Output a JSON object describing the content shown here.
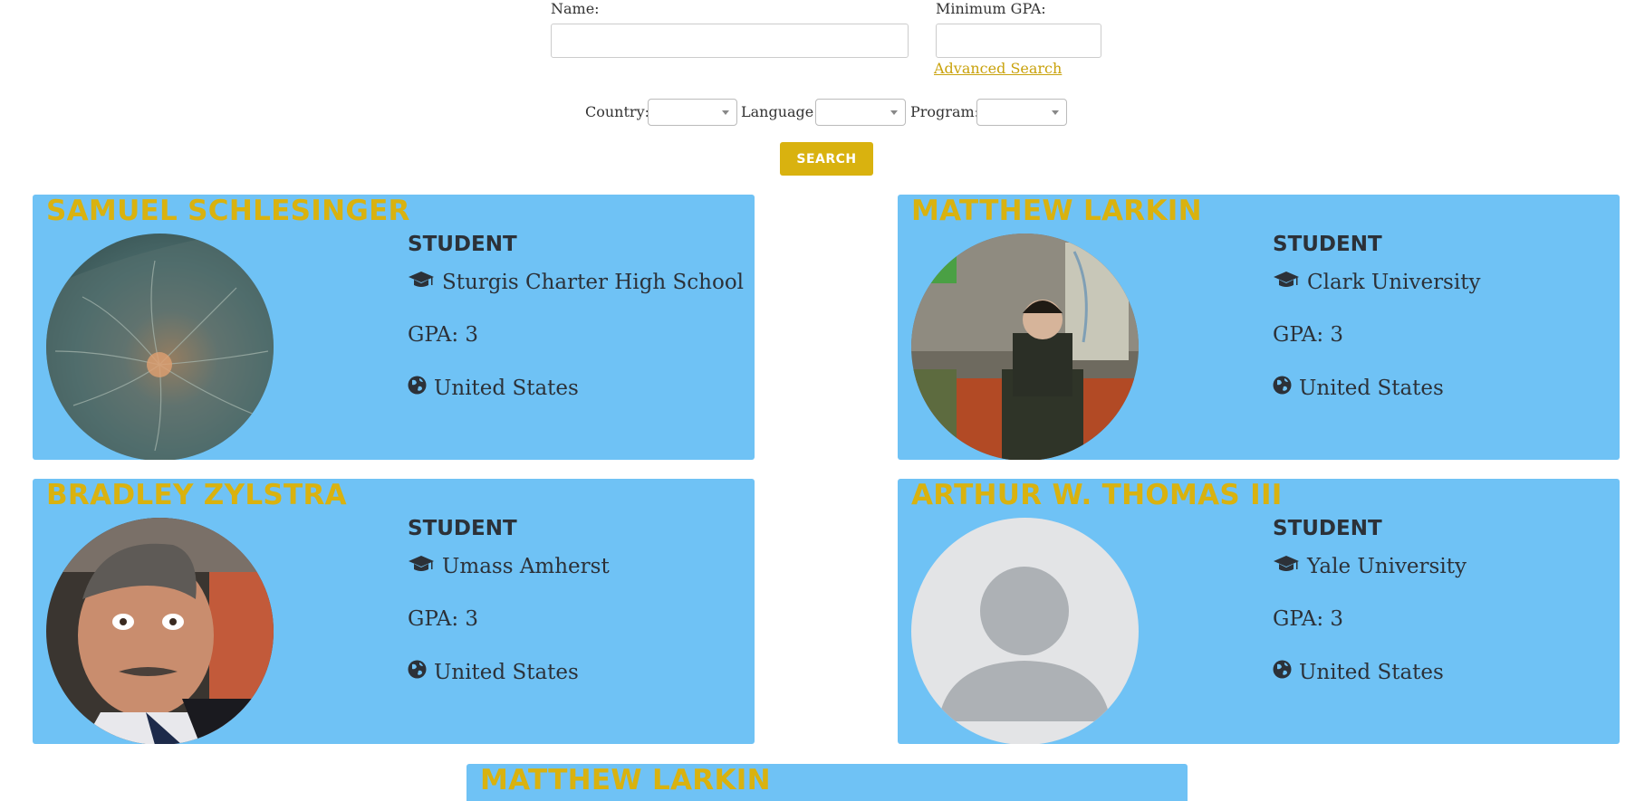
{
  "search": {
    "name_label": "Name:",
    "name_value": "",
    "gpa_label": "Minimum GPA:",
    "gpa_value": "",
    "advanced_link": "Advanced Search",
    "country_label": "Country:",
    "language_label": "Language:",
    "program_label": "Program:",
    "button_label": "SEARCH"
  },
  "colors": {
    "card_bg": "#6fc2f5",
    "accent": "#d9b20f"
  },
  "cards": [
    {
      "name": "SAMUEL SCHLESINGER",
      "role": "STUDENT",
      "school": "Sturgis Charter High School",
      "gpa": "GPA: 3",
      "country": "United States",
      "avatar": "solar-flare-photo"
    },
    {
      "name": "MATTHEW LARKIN",
      "role": "STUDENT",
      "school": "Clark University",
      "gpa": "GPA: 3",
      "country": "United States",
      "avatar": "subway-man-photo"
    },
    {
      "name": "BRADLEY ZYLSTRA",
      "role": "STUDENT",
      "school": "Umass Amherst",
      "gpa": "GPA: 3",
      "country": "United States",
      "avatar": "man-portrait-photo"
    },
    {
      "name": "ARTHUR W. THOMAS III",
      "role": "STUDENT",
      "school": "Yale University",
      "gpa": "GPA: 3",
      "country": "United States",
      "avatar": "default-user-icon"
    },
    {
      "name": "MATTHEW LARKIN"
    }
  ]
}
